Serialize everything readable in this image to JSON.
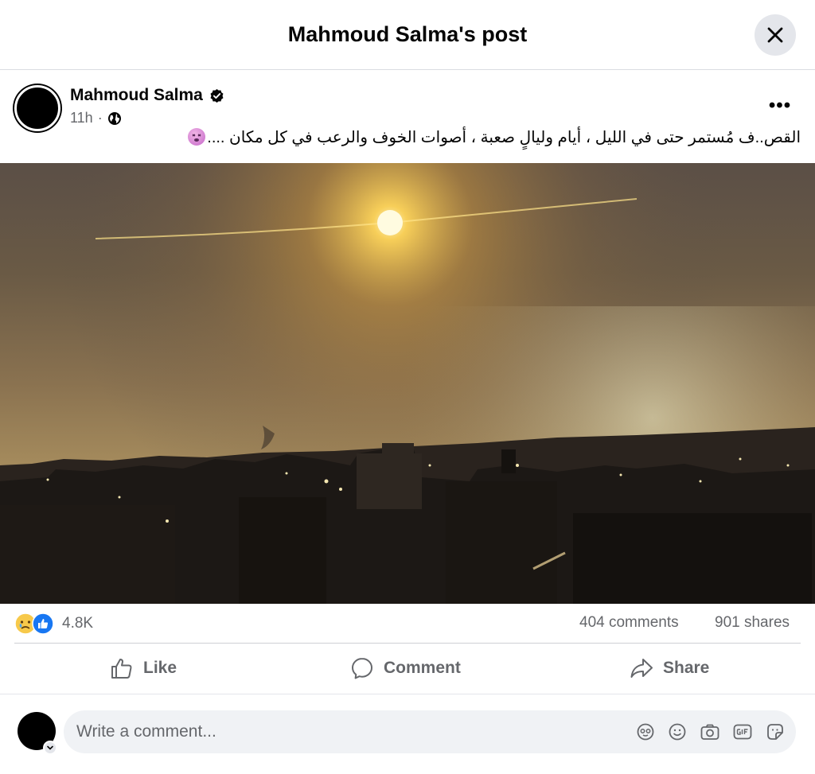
{
  "header": {
    "title": "Mahmoud Salma's post"
  },
  "post": {
    "author": "Mahmoud Salma",
    "time": "11h",
    "separator": "·",
    "text": "القص..ف مُستمر حتى في الليل ، أيام وليالٍ صعبة ، أصوات الخوف والرعب في كل مكان ....",
    "menu_label": "•••"
  },
  "stats": {
    "reactions": "4.8K",
    "comments": "404 comments",
    "shares": "901 shares"
  },
  "actions": {
    "like": "Like",
    "comment": "Comment",
    "share": "Share"
  },
  "composer": {
    "placeholder": "Write a comment..."
  },
  "colors": {
    "primary_text": "#050505",
    "secondary_text": "#65676b",
    "like_blue": "#1877f2",
    "divider": "#ced0d4",
    "input_bg": "#f0f2f5"
  },
  "icons": [
    "close-icon",
    "verified-badge-icon",
    "globe-icon",
    "more-icon",
    "sad-reaction-icon",
    "like-reaction-icon",
    "like-icon",
    "comment-icon",
    "share-icon",
    "avatar-sticker-icon",
    "emoji-icon",
    "camera-icon",
    "gif-icon",
    "sticker-icon"
  ]
}
